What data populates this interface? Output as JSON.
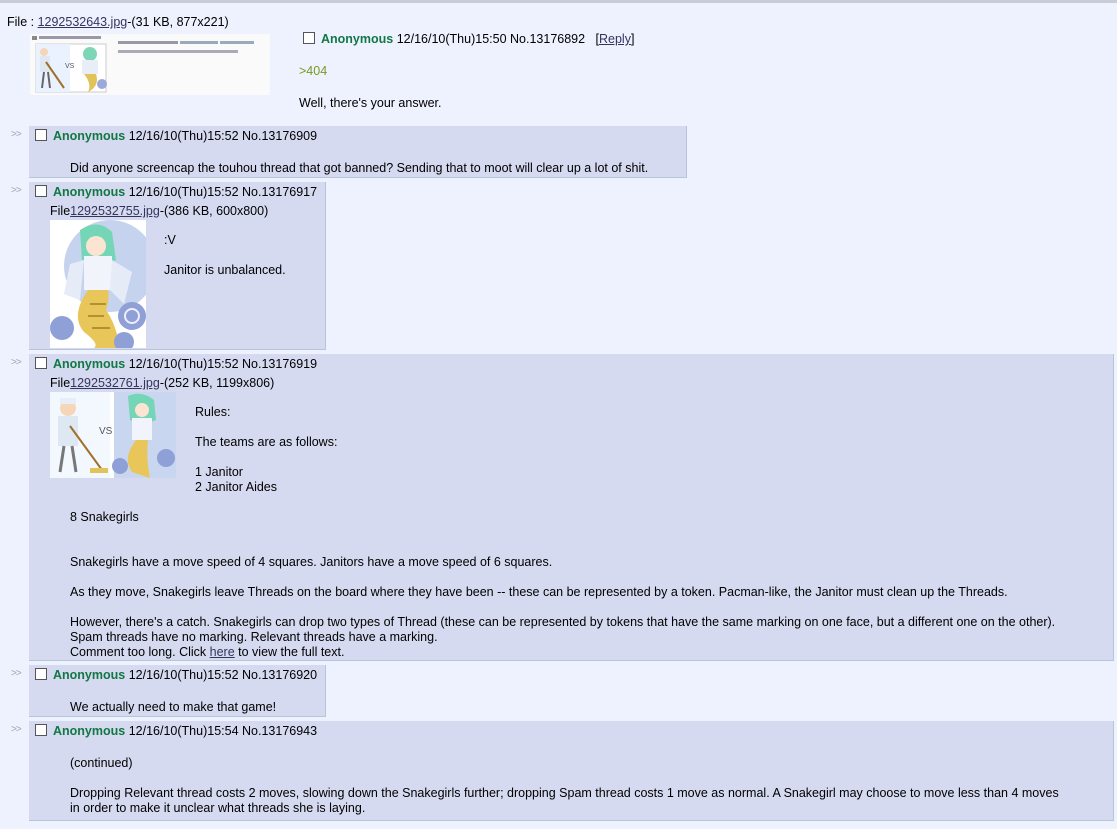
{
  "op": {
    "file_label": "File : ",
    "file_name": "1292532643.jpg",
    "file_meta": "-(31 KB, 877x221)",
    "name": "Anonymous",
    "datetime": "12/16/10(Thu)15:50",
    "post_no": "No.13176892",
    "reply_open": "[",
    "reply_link": "Reply",
    "reply_close": "]",
    "lines": [
      ">404",
      "Well, there's your answer."
    ]
  },
  "replies": [
    {
      "name": "Anonymous",
      "datetime": "12/16/10(Thu)15:52",
      "post_no": "No.13176909",
      "lines": [
        "Did anyone screencap the touhou thread that got banned? Sending that to moot will clear up a lot of shit."
      ]
    },
    {
      "name": "Anonymous",
      "datetime": "12/16/10(Thu)15:52",
      "post_no": "No.13176917",
      "file_label": "File",
      "file_name": "1292532755.jpg",
      "file_meta": "-(386 KB, 600x800)",
      "lines": [
        ":V",
        "Janitor is unbalanced."
      ]
    },
    {
      "name": "Anonymous",
      "datetime": "12/16/10(Thu)15:52",
      "post_no": "No.13176919",
      "file_label": "File",
      "file_name": "1292532761.jpg",
      "file_meta": "-(252 KB, 1199x806)",
      "vs_text": "VS",
      "lines": [
        "Rules:",
        "The teams are as follows:",
        "1 Janitor",
        "2 Janitor Aides",
        "8 Snakegirls",
        "Snakegirls have a move speed of 4 squares. Janitors have a move speed of 6 squares.",
        "As they move, Snakegirls leave Threads on the board where they have been -- these can be represented by a token. Pacman-like, the Janitor must clean up the Threads.",
        "However, there's a catch. Snakegirls can drop two types of Thread (these can be represented by tokens that have the same marking on one face, but a different one on the other).",
        "Spam threads have no marking. Relevant threads have a marking."
      ],
      "abbr_pre": "Comment too long. Click ",
      "abbr_link": "here",
      "abbr_post": " to view the full text."
    },
    {
      "name": "Anonymous",
      "datetime": "12/16/10(Thu)15:52",
      "post_no": "No.13176920",
      "lines": [
        "We actually need to make that game!"
      ]
    },
    {
      "name": "Anonymous",
      "datetime": "12/16/10(Thu)15:54",
      "post_no": "No.13176943",
      "lines": [
        "(continued)",
        "Dropping Relevant thread costs 2 moves, slowing down the Snakegirls further; dropping Spam thread costs 1 move as normal. A Snakegirl may choose to move less than 4 moves",
        "in order to make it unclear what threads she is laying."
      ]
    }
  ],
  "reply_arrow": ">>",
  "colors": {
    "name": "#117743",
    "quote": "#789922",
    "reply_bg": "#d6daf0",
    "page_bg": "#eef2ff"
  }
}
